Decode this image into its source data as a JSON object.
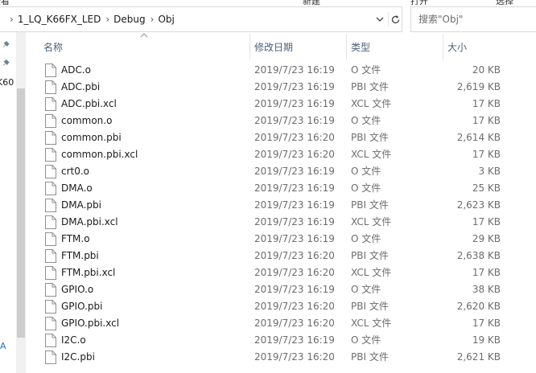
{
  "top_strip": [
    "查看",
    "新建",
    "打开",
    "选择"
  ],
  "breadcrumb": [
    "1_LQ_K66FX_LED",
    "Debug",
    "Obj"
  ],
  "search": {
    "placeholder": "搜索\"Obj\""
  },
  "nav_pane": {
    "truncated_label": "K60",
    "truncated_label_2": "A"
  },
  "columns": {
    "name": "名称",
    "date": "修改日期",
    "type": "类型",
    "size": "大小"
  },
  "sort_column": "name",
  "files": [
    {
      "name": "ADC.o",
      "date": "2019/7/23 16:19",
      "type": "O 文件",
      "size": "20 KB"
    },
    {
      "name": "ADC.pbi",
      "date": "2019/7/23 16:19",
      "type": "PBI 文件",
      "size": "2,619 KB"
    },
    {
      "name": "ADC.pbi.xcl",
      "date": "2019/7/23 16:19",
      "type": "XCL 文件",
      "size": "17 KB"
    },
    {
      "name": "common.o",
      "date": "2019/7/23 16:19",
      "type": "O 文件",
      "size": "17 KB"
    },
    {
      "name": "common.pbi",
      "date": "2019/7/23 16:20",
      "type": "PBI 文件",
      "size": "2,614 KB"
    },
    {
      "name": "common.pbi.xcl",
      "date": "2019/7/23 16:20",
      "type": "XCL 文件",
      "size": "17 KB"
    },
    {
      "name": "crt0.o",
      "date": "2019/7/23 16:19",
      "type": "O 文件",
      "size": "3 KB"
    },
    {
      "name": "DMA.o",
      "date": "2019/7/23 16:19",
      "type": "O 文件",
      "size": "25 KB"
    },
    {
      "name": "DMA.pbi",
      "date": "2019/7/23 16:19",
      "type": "PBI 文件",
      "size": "2,623 KB"
    },
    {
      "name": "DMA.pbi.xcl",
      "date": "2019/7/23 16:19",
      "type": "XCL 文件",
      "size": "17 KB"
    },
    {
      "name": "FTM.o",
      "date": "2019/7/23 16:19",
      "type": "O 文件",
      "size": "29 KB"
    },
    {
      "name": "FTM.pbi",
      "date": "2019/7/23 16:20",
      "type": "PBI 文件",
      "size": "2,638 KB"
    },
    {
      "name": "FTM.pbi.xcl",
      "date": "2019/7/23 16:20",
      "type": "XCL 文件",
      "size": "17 KB"
    },
    {
      "name": "GPIO.o",
      "date": "2019/7/23 16:19",
      "type": "O 文件",
      "size": "38 KB"
    },
    {
      "name": "GPIO.pbi",
      "date": "2019/7/23 16:20",
      "type": "PBI 文件",
      "size": "2,620 KB"
    },
    {
      "name": "GPIO.pbi.xcl",
      "date": "2019/7/23 16:20",
      "type": "XCL 文件",
      "size": "17 KB"
    },
    {
      "name": "I2C.o",
      "date": "2019/7/23 16:19",
      "type": "O 文件",
      "size": "19 KB"
    },
    {
      "name": "I2C.pbi",
      "date": "2019/7/23 16:20",
      "type": "PBI 文件",
      "size": "2,621 KB"
    }
  ],
  "icons": {
    "file": "blank-document-icon",
    "pin": "pin-icon",
    "refresh": "refresh-icon",
    "dropdown": "chevron-down-icon",
    "separator": "chevron-right-icon",
    "sort": "sort-ascending-icon"
  },
  "colors": {
    "header_text": "#4c607a",
    "row_text": "#1a1a1a",
    "secondary_text": "#6d6d6d",
    "border": "#d9d9d9",
    "scrollbar_track": "#f0f0f0",
    "scrollbar_thumb": "#cdcdcd"
  }
}
